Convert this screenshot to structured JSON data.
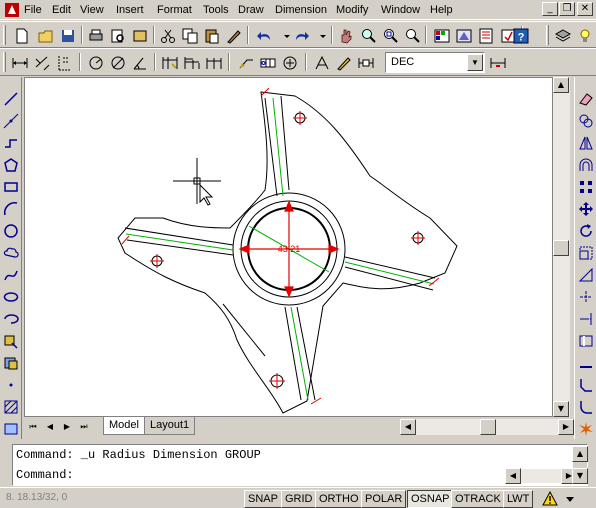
{
  "menu": {
    "items": [
      "File",
      "Edit",
      "View",
      "Insert",
      "Format",
      "Tools",
      "Draw",
      "Dimension",
      "Modify",
      "Window",
      "Help"
    ]
  },
  "window_controls": {
    "minimize": "_",
    "restore": "❐",
    "close": "✕"
  },
  "dim_style_combo": {
    "value": "DEC"
  },
  "drawing": {
    "dimension_text": "43.21"
  },
  "tabs": {
    "nav": [
      "⏮",
      "◀",
      "▶",
      "⏭"
    ],
    "items": [
      {
        "label": "Model",
        "active": true
      },
      {
        "label": "Layout1",
        "active": false
      }
    ]
  },
  "command": {
    "history_line": "Command: _u Radius Dimension GROUP",
    "prompt_line": "Command:"
  },
  "status": {
    "coordinates": "8.   18.13/32, 0",
    "toggles": [
      {
        "label": "SNAP",
        "on": false
      },
      {
        "label": "GRID",
        "on": false
      },
      {
        "label": "ORTHO",
        "on": false
      },
      {
        "label": "POLAR",
        "on": false
      },
      {
        "label": "OSNAP",
        "on": true
      },
      {
        "label": "OTRACK",
        "on": false
      },
      {
        "label": "LWT",
        "on": false
      }
    ]
  },
  "colors": {
    "dimension": "#e00000",
    "centerline": "#00b000",
    "ui_face": "#d4d0c8"
  }
}
